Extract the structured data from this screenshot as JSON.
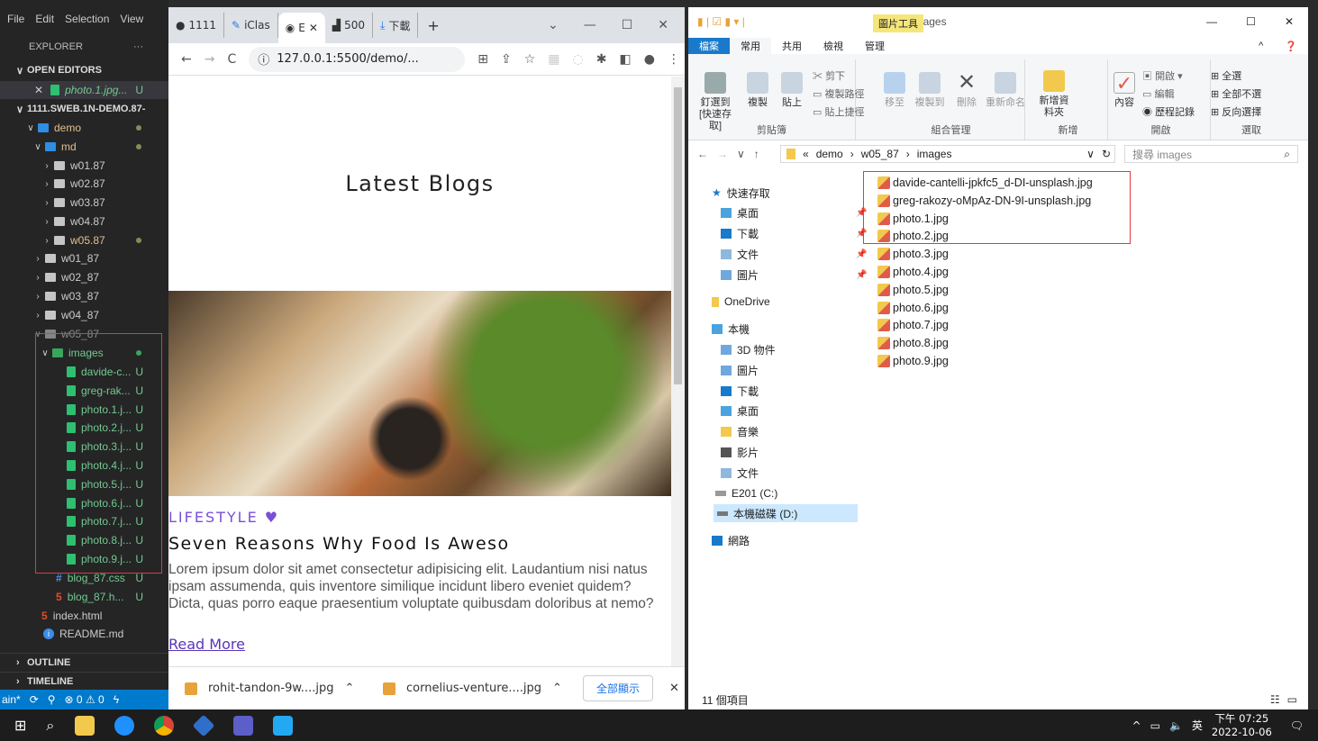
{
  "vscode": {
    "menu": [
      "File",
      "Edit",
      "Selection",
      "View"
    ],
    "explorer_label": "EXPLORER",
    "more_label": "···",
    "open_editors_label": "OPEN EDITORS",
    "open_editor_file": "photo.1.jpg...",
    "open_editor_status": "U",
    "workspace_label": "1111.SWEB.1N-DEMO.87-",
    "tree": {
      "demo": "demo",
      "md": "md",
      "w01_87_dot": "w01.87",
      "w02_87_dot": "w02.87",
      "w03_87_dot": "w03.87",
      "w04_87_dot": "w04.87",
      "w05_87_dot": "w05.87",
      "w01_87": "w01_87",
      "w02_87": "w02_87",
      "w03_87": "w03_87",
      "w04_87": "w04_87",
      "w05_87": "w05_87",
      "images": "images",
      "image_files": [
        "davide-c...",
        "greg-rak...",
        "photo.1.j...",
        "photo.2.j...",
        "photo.3.j...",
        "photo.4.j...",
        "photo.5.j...",
        "photo.6.j...",
        "photo.7.j...",
        "photo.8.j...",
        "photo.9.j..."
      ],
      "blog_css": "blog_87.css",
      "blog_html": "blog_87.h...",
      "index_html": "index.html",
      "readme": "README.md",
      "u": "U"
    },
    "outline_label": "OUTLINE",
    "timeline_label": "TIMELINE",
    "status": {
      "branch": "ain*",
      "errors": "⊗ 0 ⚠ 0"
    }
  },
  "chrome": {
    "tabs": [
      "1111",
      "iClas",
      "E",
      "500",
      "下載"
    ],
    "url": "127.0.0.1:5500/demo/...",
    "page": {
      "title": "Latest Blogs",
      "category": "LIFESTYLE",
      "post_title": "Seven Reasons Why Food Is Aweso",
      "post_body": "Lorem ipsum dolor sit amet consectetur adipisicing elit. Laudantium nisi natus ipsam assumenda, quis inventore similique incidunt libero eveniet quidem? Dicta, quas porro eaque praesentium voluptate quibusdam doloribus at nemo?",
      "read_more": "Read More"
    },
    "downloads": {
      "items": [
        "rohit-tandon-9w....jpg",
        "cornelius-venture....jpg"
      ],
      "show_all": "全部顯示"
    }
  },
  "explorer": {
    "title": "images",
    "tool_tab": "圖片工具",
    "tabs": [
      "檔案",
      "常用",
      "共用",
      "檢視",
      "管理"
    ],
    "ribbon": {
      "pin": "釘選到 [快速存取]",
      "copy": "複製",
      "paste": "貼上",
      "cut": "剪下",
      "copy_path": "複製路徑",
      "paste_shortcut": "貼上捷徑",
      "clipboard": "剪貼簿",
      "move_to": "移至",
      "copy_to": "複製到",
      "delete": "刪除",
      "rename": "重新命名",
      "organize": "組合管理",
      "new_folder": "新增資料夾",
      "new": "新增",
      "properties": "內容",
      "open_btn": "開啟",
      "edit": "編輯",
      "history": "歷程記錄",
      "open": "開啟",
      "select_all": "全選",
      "select_none": "全部不選",
      "invert": "反向選擇",
      "select": "選取"
    },
    "path": [
      "«",
      "demo",
      "w05_87",
      "images"
    ],
    "search_placeholder": "搜尋 images",
    "sidebar": {
      "quick_access": "快速存取",
      "desktop": "桌面",
      "downloads": "下載",
      "documents": "文件",
      "pictures": "圖片",
      "onedrive": "OneDrive",
      "this_pc": "本機",
      "objects3d": "3D 物件",
      "pictures2": "圖片",
      "downloads2": "下載",
      "desktop2": "桌面",
      "music": "音樂",
      "videos": "影片",
      "documents2": "文件",
      "drive_c": "E201 (C:)",
      "drive_d": "本機磁碟 (D:)",
      "network": "網路"
    },
    "files": [
      "davide-cantelli-jpkfc5_d-DI-unsplash.jpg",
      "greg-rakozy-oMpAz-DN-9I-unsplash.jpg",
      "photo.1.jpg",
      "photo.2.jpg",
      "photo.3.jpg",
      "photo.4.jpg",
      "photo.5.jpg",
      "photo.6.jpg",
      "photo.7.jpg",
      "photo.8.jpg",
      "photo.9.jpg"
    ],
    "status": "11 個項目"
  },
  "taskbar": {
    "ime": "英",
    "time": "下午 07:25",
    "date": "2022-10-06"
  }
}
